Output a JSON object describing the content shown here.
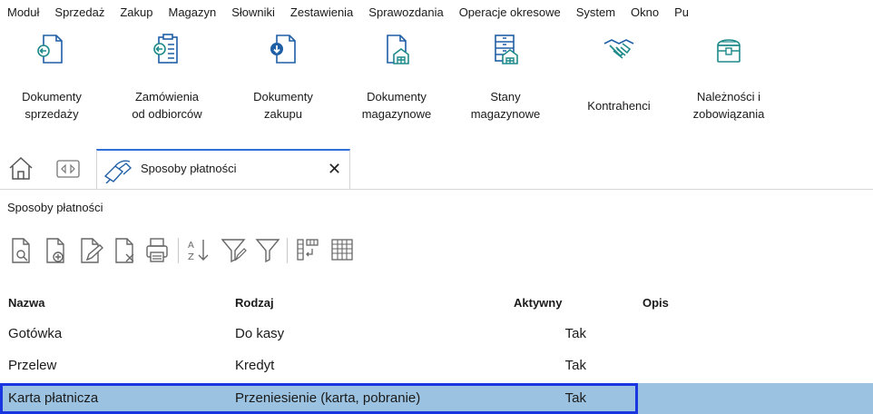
{
  "menu": [
    "Moduł",
    "Sprzedaż",
    "Zakup",
    "Magazyn",
    "Słowniki",
    "Zestawienia",
    "Sprawozdania",
    "Operacje okresowe",
    "System",
    "Okno",
    "Pu"
  ],
  "ribbon": [
    {
      "line1": "Dokumenty",
      "line2": "sprzedaży",
      "icon": "doc-arrow-left-icon"
    },
    {
      "line1": "Zamówienia",
      "line2": "od odbiorców",
      "icon": "order-list-icon"
    },
    {
      "line1": "Dokumenty",
      "line2": "zakupu",
      "icon": "doc-arrow-right-icon"
    },
    {
      "line1": "Dokumenty",
      "line2": "magazynowe",
      "icon": "warehouse-doc-icon"
    },
    {
      "line1": "Stany",
      "line2": "magazynowe",
      "icon": "warehouse-stock-icon"
    },
    {
      "line1": "Kontrahenci",
      "line2": "",
      "icon": "handshake-icon"
    },
    {
      "line1": "Należności i",
      "line2": "zobowiązania",
      "icon": "treasure-chest-icon"
    }
  ],
  "tab": {
    "title": "Sposoby płatności",
    "close": "✕"
  },
  "section_title": "Sposoby płatności",
  "table": {
    "headers": {
      "name": "Nazwa",
      "type": "Rodzaj",
      "active": "Aktywny",
      "desc": "Opis"
    },
    "rows": [
      {
        "name": "Gotówka",
        "type": "Do kasy",
        "active": "Tak",
        "desc": ""
      },
      {
        "name": "Przelew",
        "type": "Kredyt",
        "active": "Tak",
        "desc": ""
      },
      {
        "name": "Karta płatnicza",
        "type": "Przeniesienie (karta, pobranie)",
        "active": "Tak",
        "desc": ""
      }
    ],
    "selected_row": 2
  },
  "colors": {
    "accent": "#2f6fd6",
    "icon_teal": "#1f8a8a",
    "icon_blue": "#1f5fa6",
    "selection": "#9bc2e0",
    "selection_border": "#1936e0"
  }
}
